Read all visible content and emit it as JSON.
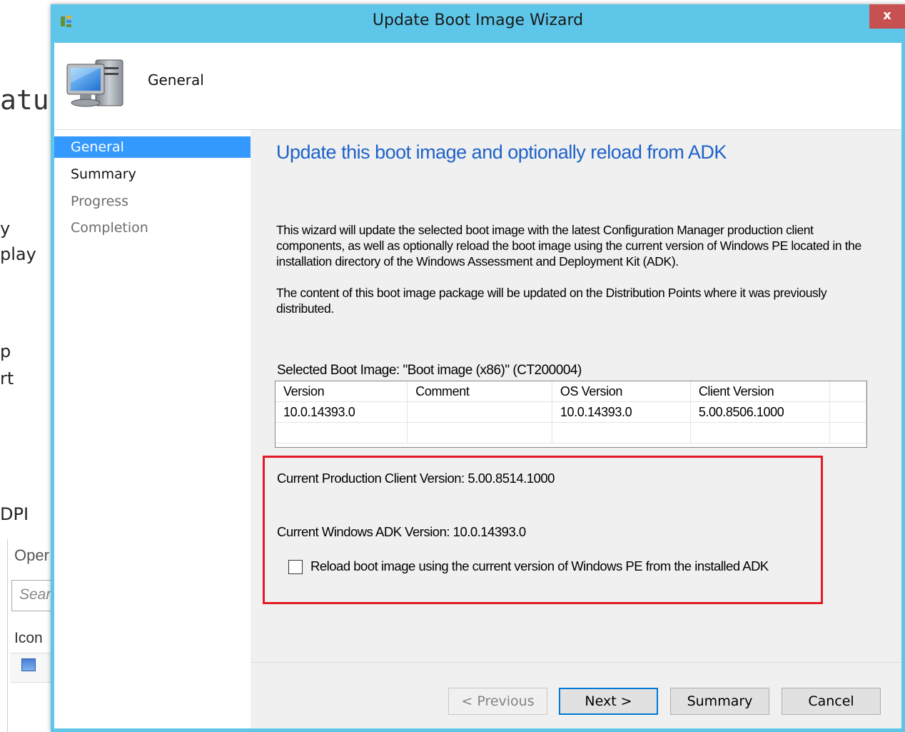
{
  "background": {
    "big_text": "atu",
    "fragments": [
      "y",
      "play",
      "p",
      "rt",
      "DPI"
    ],
    "open_label": "Oper",
    "search_placeholder": "Sear",
    "icon_header": "Icon"
  },
  "window": {
    "title": "Update Boot Image Wizard",
    "close_label": "x",
    "header_title": "General"
  },
  "nav": {
    "items": [
      {
        "label": "General",
        "state": "active"
      },
      {
        "label": "Summary",
        "state": "normal"
      },
      {
        "label": "Progress",
        "state": "disabled"
      },
      {
        "label": "Completion",
        "state": "disabled"
      }
    ]
  },
  "main": {
    "heading": "Update this boot image and optionally reload from ADK",
    "para1": "This wizard will update the selected boot image with the latest Configuration Manager production client components, as well as optionally reload the boot image using the current version of Windows PE located in the installation directory of the Windows Assessment and Deployment Kit (ADK).",
    "para2": "The content of this boot image package will be updated on the Distribution Points where it was previously distributed.",
    "selected_label": "Selected Boot Image: \"Boot image (x86)\" (CT200004)",
    "grid": {
      "headers": [
        "Version",
        "Comment",
        "OS Version",
        "Client Version"
      ],
      "rows": [
        [
          "10.0.14393.0",
          "",
          "10.0.14393.0",
          "5.00.8506.1000"
        ]
      ]
    },
    "current_client": "Current Production Client Version: 5.00.8514.1000",
    "current_adk": "Current Windows ADK Version: 10.0.14393.0",
    "reload_label": "Reload boot image using the current version of Windows PE from the installed ADK",
    "reload_checked": false
  },
  "buttons": {
    "previous": "< Previous",
    "next": "Next >",
    "summary": "Summary",
    "cancel": "Cancel"
  },
  "colors": {
    "titlebar": "#5ec6e8",
    "accent_heading": "#1e62c8",
    "nav_selected": "#3399ff",
    "highlight_border": "#e21b26",
    "close_button": "#c75050"
  }
}
